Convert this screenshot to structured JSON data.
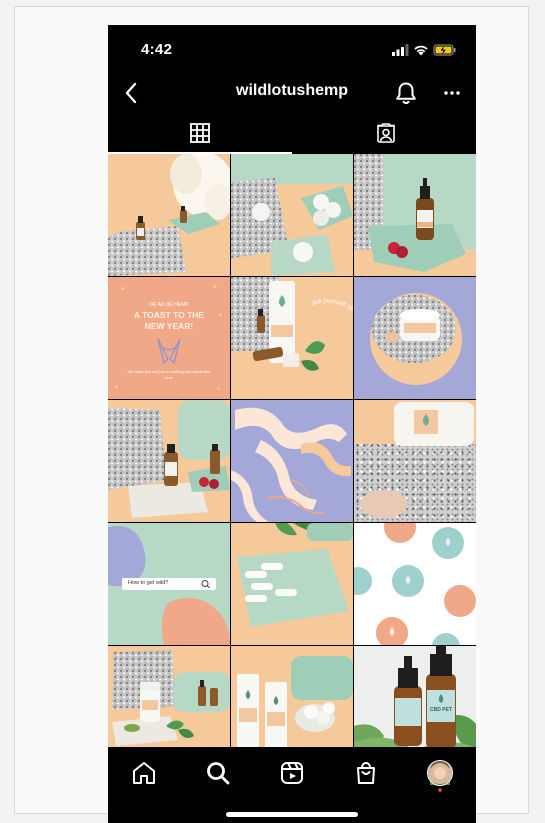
{
  "status": {
    "time": "4:42"
  },
  "header": {
    "username": "wildlotushemp"
  },
  "posts": {
    "toast_kicker": "DE AU DE HEMP",
    "toast_line1": "A TOAST TO THE",
    "toast_line2": "NEW YEAR!",
    "toast_sub": "We hope you will join in wishing you wheel fine time",
    "arc_text": "ask yourself, shop hemp",
    "search_text": "How to get wild?",
    "cbd_label": "CBD PET"
  },
  "colors": {
    "peach": "#f6c99a",
    "mint": "#b8d8c6",
    "lavender": "#a3a8d9",
    "coral": "#f0a889",
    "notification": "#ed4956"
  }
}
